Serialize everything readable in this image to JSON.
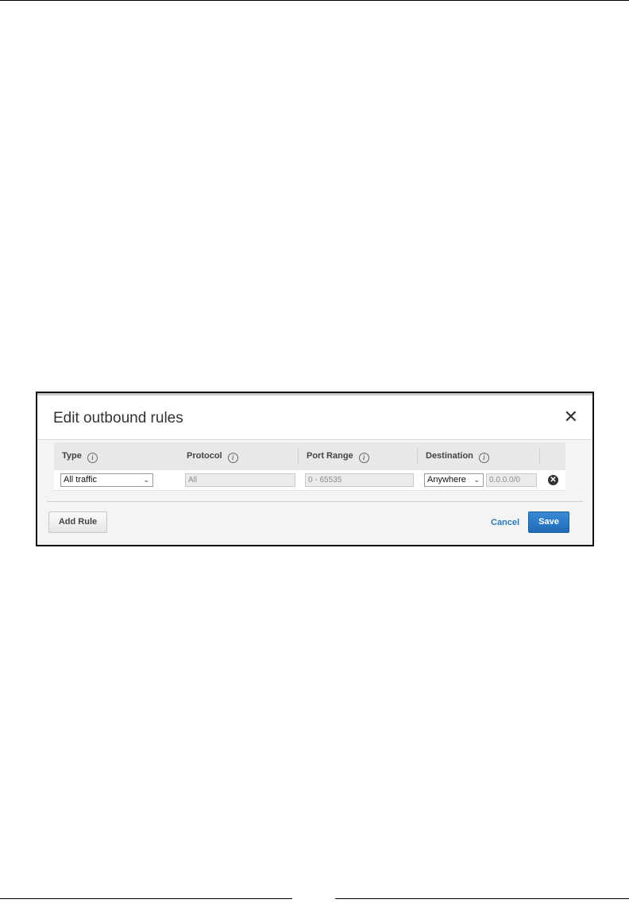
{
  "modal": {
    "title": "Edit outbound rules",
    "close_glyph": "✕"
  },
  "table": {
    "headers": {
      "type": "Type",
      "protocol": "Protocol",
      "port_range": "Port Range",
      "destination": "Destination"
    },
    "rows": [
      {
        "type": "All traffic",
        "protocol": "All",
        "port_range": "0 - 65535",
        "destination_select": "Anywhere",
        "destination_cidr": "0.0.0.0/0"
      }
    ]
  },
  "actions": {
    "add_rule": "Add Rule",
    "cancel": "Cancel",
    "save": "Save"
  },
  "colors": {
    "primary_button": "#2a7ab8",
    "link": "#2a7ab8"
  },
  "icons": {
    "info": "i",
    "remove": "✕",
    "chevron": "⌄"
  }
}
